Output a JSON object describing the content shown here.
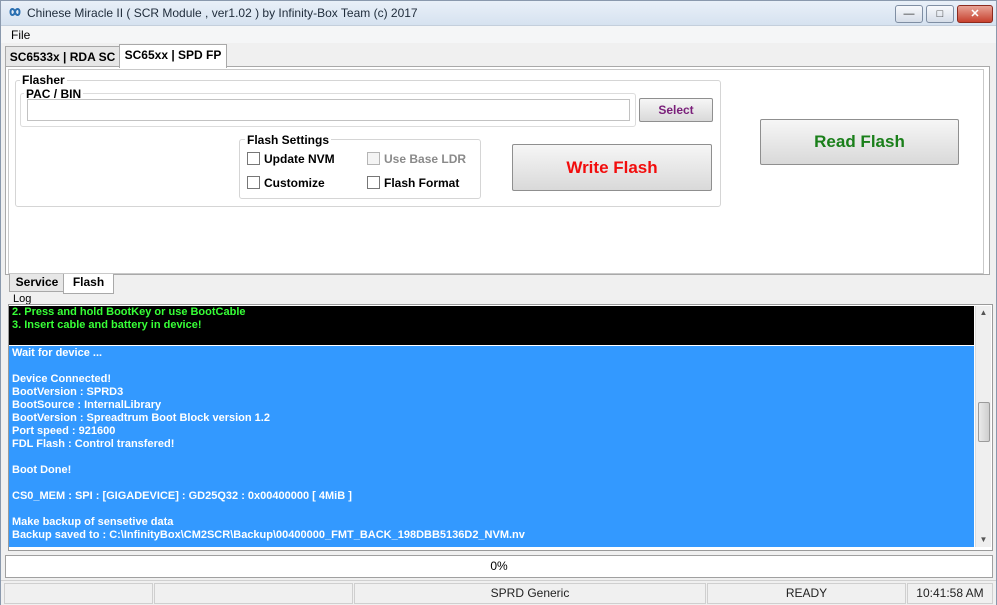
{
  "window": {
    "title": "Chinese Miracle II ( SCR Module , ver1.02  ) by Infinity-Box Team (c) 2017",
    "icon": "infinity-icon",
    "minimize": "—",
    "maximize": "□",
    "close": "✕"
  },
  "menu": {
    "file": "File"
  },
  "top_tabs": [
    "SC6533x | RDA SC",
    "SC65xx | SPD FP"
  ],
  "flasher": {
    "group_label": "Flasher",
    "pac_label": "PAC / BIN",
    "pac_value": "",
    "select_label": "Select",
    "flash_settings_label": "Flash Settings",
    "checkboxes": {
      "update_nvm": "Update NVM",
      "use_base_ldr": "Use Base LDR",
      "customize": "Customize",
      "flash_format": "Flash Format"
    },
    "write_label": "Write Flash",
    "read_label": "Read Flash"
  },
  "bottom_tabs": [
    "Service",
    "Flash"
  ],
  "log": {
    "label": "Log",
    "black_lines": [
      "2. Press and hold BootKey or use BootCable",
      "3. Insert cable and battery in device!"
    ],
    "blue_lines": [
      "Wait for device ...",
      "",
      "Device Connected!",
      "BootVersion : SPRD3",
      "BootSource  :  InternalLibrary",
      "BootVersion : Spreadtrum Boot Block version 1.2",
      "Port speed : 921600",
      "FDL Flash  : Control transfered!",
      "",
      "Boot Done!",
      "",
      "CS0_MEM : SPI : [GIGADEVICE] : GD25Q32 : 0x00400000 [ 4MiB ]",
      "",
      "Make backup of sensetive data",
      "Backup saved to : C:\\InfinityBox\\CM2SCR\\Backup\\00400000_FMT_BACK_198DBB5136D2_NVM.nv"
    ]
  },
  "progress": {
    "text": "0%",
    "value": 0
  },
  "status": {
    "platform": "SPRD Generic",
    "state": "READY",
    "time": "10:41:58 AM"
  }
}
